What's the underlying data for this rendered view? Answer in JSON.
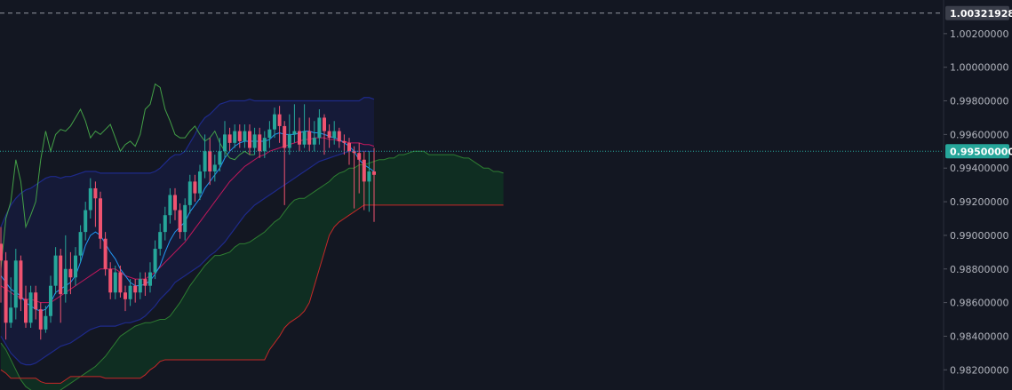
{
  "chart_data": {
    "type": "candlestick",
    "y_axis": {
      "ticks": [
        "1.00200000",
        "1.00000000",
        "0.99800000",
        "0.99600000",
        "0.99400000",
        "0.99200000",
        "0.99000000",
        "0.98800000",
        "0.98600000",
        "0.98400000",
        "0.98200000"
      ],
      "tick_values": [
        1.002,
        1.0,
        0.998,
        0.996,
        0.994,
        0.992,
        0.99,
        0.988,
        0.986,
        0.984,
        0.982
      ],
      "range": [
        0.9808,
        1.004
      ],
      "side": "right"
    },
    "price_lines": [
      {
        "label": "1.00321928",
        "value": 1.00321928,
        "style": "dashed",
        "line_color": "#9598a1",
        "tag_bg": "#3a3e4a",
        "tag_fg": "#ffffff"
      },
      {
        "label": "0.99500000",
        "value": 0.995,
        "style": "dotted",
        "line_color": "#26a69a",
        "tag_bg": "#26a69a",
        "tag_fg": "#ffffff"
      }
    ],
    "candles": [
      [
        0.9895,
        0.9885,
        0.986,
        0.9905
      ],
      [
        0.9885,
        0.9848,
        0.9838,
        0.989
      ],
      [
        0.9848,
        0.9857,
        0.9845,
        0.9875
      ],
      [
        0.9857,
        0.9885,
        0.985,
        0.9892
      ],
      [
        0.9885,
        0.9862,
        0.9855,
        0.9888
      ],
      [
        0.9862,
        0.9848,
        0.9845,
        0.987
      ],
      [
        0.9848,
        0.9866,
        0.9845,
        0.987
      ],
      [
        0.9866,
        0.9856,
        0.985,
        0.987
      ],
      [
        0.9856,
        0.9844,
        0.9838,
        0.986
      ],
      [
        0.9844,
        0.9852,
        0.9842,
        0.9858
      ],
      [
        0.9852,
        0.987,
        0.9848,
        0.9876
      ],
      [
        0.987,
        0.9888,
        0.9865,
        0.9893
      ],
      [
        0.9888,
        0.9865,
        0.9848,
        0.9892
      ],
      [
        0.9865,
        0.988,
        0.986,
        0.99
      ],
      [
        0.988,
        0.9875,
        0.9865,
        0.989
      ],
      [
        0.9875,
        0.9888,
        0.987,
        0.9893
      ],
      [
        0.9888,
        0.9902,
        0.9884,
        0.9906
      ],
      [
        0.9902,
        0.9915,
        0.9897,
        0.992
      ],
      [
        0.9915,
        0.9928,
        0.991,
        0.9934
      ],
      [
        0.9928,
        0.9922,
        0.9905,
        0.9932
      ],
      [
        0.9922,
        0.9898,
        0.9892,
        0.9926
      ],
      [
        0.9898,
        0.988,
        0.9876,
        0.9902
      ],
      [
        0.988,
        0.9866,
        0.9862,
        0.9884
      ],
      [
        0.9866,
        0.9878,
        0.9862,
        0.9882
      ],
      [
        0.9878,
        0.9866,
        0.9863,
        0.9882
      ],
      [
        0.9866,
        0.9862,
        0.9855,
        0.987
      ],
      [
        0.9862,
        0.987,
        0.9858,
        0.9874
      ],
      [
        0.987,
        0.9866,
        0.986,
        0.9874
      ],
      [
        0.9866,
        0.9874,
        0.9862,
        0.9878
      ],
      [
        0.9874,
        0.987,
        0.9864,
        0.9878
      ],
      [
        0.987,
        0.9878,
        0.9866,
        0.9884
      ],
      [
        0.9878,
        0.9892,
        0.9874,
        0.9897
      ],
      [
        0.9892,
        0.9902,
        0.9888,
        0.9907
      ],
      [
        0.9902,
        0.9912,
        0.9897,
        0.9917
      ],
      [
        0.9912,
        0.9924,
        0.9907,
        0.9928
      ],
      [
        0.9924,
        0.9915,
        0.9909,
        0.9928
      ],
      [
        0.9915,
        0.9902,
        0.9898,
        0.9919
      ],
      [
        0.9902,
        0.9918,
        0.9897,
        0.9922
      ],
      [
        0.9918,
        0.9932,
        0.9913,
        0.9936
      ],
      [
        0.9932,
        0.9925,
        0.992,
        0.9936
      ],
      [
        0.9925,
        0.9938,
        0.9921,
        0.9942
      ],
      [
        0.9938,
        0.995,
        0.9934,
        0.996
      ],
      [
        0.995,
        0.9938,
        0.993,
        0.9958
      ],
      [
        0.9938,
        0.9942,
        0.9932,
        0.9948
      ],
      [
        0.9942,
        0.995,
        0.9938,
        0.9958
      ],
      [
        0.995,
        0.996,
        0.9946,
        0.9968
      ],
      [
        0.996,
        0.9955,
        0.995,
        0.9964
      ],
      [
        0.9955,
        0.9962,
        0.9952,
        0.9966
      ],
      [
        0.9962,
        0.9956,
        0.9952,
        0.9966
      ],
      [
        0.9956,
        0.9962,
        0.9952,
        0.9966
      ],
      [
        0.9962,
        0.9952,
        0.9948,
        0.9966
      ],
      [
        0.9952,
        0.996,
        0.9948,
        0.9964
      ],
      [
        0.996,
        0.995,
        0.9946,
        0.9964
      ],
      [
        0.995,
        0.9958,
        0.9946,
        0.9962
      ],
      [
        0.9958,
        0.9963,
        0.9952,
        0.9968
      ],
      [
        0.9963,
        0.9972,
        0.9958,
        0.9976
      ],
      [
        0.9972,
        0.9965,
        0.9955,
        0.9977
      ],
      [
        0.9965,
        0.9952,
        0.9918,
        0.9968
      ],
      [
        0.9952,
        0.996,
        0.9948,
        0.9972
      ],
      [
        0.996,
        0.9962,
        0.9955,
        0.9978
      ],
      [
        0.9962,
        0.9954,
        0.995,
        0.997
      ],
      [
        0.9954,
        0.9962,
        0.9952,
        0.9978
      ],
      [
        0.9962,
        0.9954,
        0.995,
        0.997
      ],
      [
        0.9954,
        0.9958,
        0.995,
        0.9968
      ],
      [
        0.9958,
        0.997,
        0.9954,
        0.9975
      ],
      [
        0.997,
        0.9962,
        0.9948,
        0.9972
      ],
      [
        0.9962,
        0.9958,
        0.9952,
        0.9966
      ],
      [
        0.9958,
        0.9962,
        0.9954,
        0.9968
      ],
      [
        0.9962,
        0.9956,
        0.9952,
        0.9964
      ],
      [
        0.9956,
        0.9955,
        0.9948,
        0.996
      ],
      [
        0.9955,
        0.995,
        0.9942,
        0.9958
      ],
      [
        0.995,
        0.9949,
        0.9916,
        0.9953
      ],
      [
        0.9949,
        0.9945,
        0.9925,
        0.9955
      ],
      [
        0.9945,
        0.9932,
        0.9915,
        0.995
      ],
      [
        0.9932,
        0.9938,
        0.9914,
        0.995
      ],
      [
        0.9938,
        0.9936,
        0.9908,
        0.9952
      ]
    ],
    "tenkan_sen": [
      0.9876,
      0.9872,
      0.9868,
      0.9866,
      0.9864,
      0.986,
      0.9858,
      0.9856,
      0.9855,
      0.9856,
      0.986,
      0.9866,
      0.9868,
      0.987,
      0.9872,
      0.9876,
      0.9884,
      0.9894,
      0.99,
      0.9902,
      0.99,
      0.9895,
      0.989,
      0.9886,
      0.988,
      0.9876,
      0.9872,
      0.987,
      0.987,
      0.9871,
      0.9873,
      0.9877,
      0.9882,
      0.989,
      0.9897,
      0.9902,
      0.9905,
      0.9908,
      0.9914,
      0.9918,
      0.9922,
      0.9928,
      0.9932,
      0.9936,
      0.994,
      0.9946,
      0.995,
      0.9953,
      0.9955,
      0.9956,
      0.9956,
      0.9956,
      0.9956,
      0.9956,
      0.9957,
      0.996,
      0.9961,
      0.996,
      0.996,
      0.996,
      0.9961,
      0.9962,
      0.9962,
      0.9961,
      0.9961,
      0.996,
      0.9959,
      0.9958,
      0.9957,
      0.9955,
      0.9953,
      0.995,
      0.9945,
      0.9942,
      0.994,
      0.9938
    ],
    "kijun_sen": [
      0.987,
      0.9868,
      0.9866,
      0.9864,
      0.9863,
      0.9862,
      0.9862,
      0.9861,
      0.986,
      0.986,
      0.986,
      0.9862,
      0.9864,
      0.9866,
      0.9868,
      0.987,
      0.9872,
      0.9874,
      0.9876,
      0.9878,
      0.988,
      0.988,
      0.988,
      0.988,
      0.9878,
      0.9876,
      0.9875,
      0.9874,
      0.9874,
      0.9874,
      0.9876,
      0.9878,
      0.9881,
      0.9884,
      0.9887,
      0.989,
      0.9893,
      0.9896,
      0.99,
      0.9904,
      0.9908,
      0.9912,
      0.9916,
      0.992,
      0.9924,
      0.9928,
      0.9932,
      0.9935,
      0.9938,
      0.9941,
      0.9943,
      0.9945,
      0.9947,
      0.9948,
      0.995,
      0.9951,
      0.9952,
      0.9953,
      0.9954,
      0.9955,
      0.9956,
      0.9957,
      0.9957,
      0.9958,
      0.9958,
      0.9958,
      0.9957,
      0.9957,
      0.9956,
      0.9956,
      0.9955,
      0.9955,
      0.9955,
      0.9954,
      0.9954,
      0.9953
    ],
    "chikou_span": [
      0.988,
      0.991,
      0.992,
      0.9945,
      0.9932,
      0.9905,
      0.9912,
      0.992,
      0.9945,
      0.9962,
      0.995,
      0.996,
      0.9963,
      0.9962,
      0.9965,
      0.997,
      0.9975,
      0.9968,
      0.9958,
      0.9962,
      0.996,
      0.9963,
      0.9966,
      0.9958,
      0.995,
      0.9954,
      0.9956,
      0.9953,
      0.996,
      0.9975,
      0.9978,
      0.999,
      0.9988,
      0.9975,
      0.9968,
      0.996,
      0.9958,
      0.9958,
      0.9962,
      0.9965,
      0.996,
      0.9956,
      0.9958,
      0.9962,
      0.9955,
      0.995,
      0.9946,
      0.9945,
      0.9948,
      0.995,
      0.9948,
      0.9948
    ],
    "senkou_span_a": [
      0.9836,
      0.9832,
      0.9826,
      0.982,
      0.9814,
      0.981,
      0.9808,
      0.9806,
      0.9805,
      0.9805,
      0.9806,
      0.9806,
      0.9808,
      0.981,
      0.9812,
      0.9814,
      0.9816,
      0.9818,
      0.982,
      0.9822,
      0.9825,
      0.9828,
      0.9832,
      0.9836,
      0.984,
      0.9842,
      0.9844,
      0.9846,
      0.9847,
      0.9848,
      0.9848,
      0.9849,
      0.985,
      0.985,
      0.9852,
      0.9856,
      0.986,
      0.9865,
      0.987,
      0.9874,
      0.9878,
      0.9882,
      0.9885,
      0.9888,
      0.9888,
      0.9889,
      0.989,
      0.9893,
      0.9895,
      0.9895,
      0.9896,
      0.9898,
      0.99,
      0.9902,
      0.9905,
      0.9908,
      0.991,
      0.9914,
      0.9918,
      0.9921,
      0.9922,
      0.9922,
      0.9924,
      0.9926,
      0.9928,
      0.993,
      0.9932,
      0.9935,
      0.9937,
      0.9938,
      0.994,
      0.994,
      0.9942,
      0.9942,
      0.9943,
      0.9944,
      0.9945,
      0.9945,
      0.9946,
      0.9946,
      0.9948,
      0.9948,
      0.9949,
      0.995,
      0.995,
      0.995,
      0.9948,
      0.9948,
      0.9948,
      0.9948,
      0.9948,
      0.9948,
      0.9947,
      0.9946,
      0.9946,
      0.9944,
      0.9942,
      0.994,
      0.994,
      0.9938,
      0.9938,
      0.9937
    ],
    "senkou_span_b": [
      0.982,
      0.9818,
      0.9815,
      0.9815,
      0.9815,
      0.9815,
      0.9815,
      0.9815,
      0.9813,
      0.9812,
      0.9812,
      0.9812,
      0.9812,
      0.9814,
      0.9816,
      0.9816,
      0.9816,
      0.9816,
      0.9816,
      0.9816,
      0.9816,
      0.9815,
      0.9815,
      0.9815,
      0.9815,
      0.9815,
      0.9815,
      0.9815,
      0.9815,
      0.9817,
      0.982,
      0.9822,
      0.9825,
      0.9826,
      0.9826,
      0.9826,
      0.9826,
      0.9826,
      0.9826,
      0.9826,
      0.9826,
      0.9826,
      0.9826,
      0.9826,
      0.9826,
      0.9826,
      0.9826,
      0.9826,
      0.9826,
      0.9826,
      0.9826,
      0.9826,
      0.9826,
      0.9826,
      0.9832,
      0.9836,
      0.984,
      0.9845,
      0.9848,
      0.985,
      0.9852,
      0.9855,
      0.986,
      0.987,
      0.988,
      0.989,
      0.99,
      0.9905,
      0.9908,
      0.991,
      0.9912,
      0.9914,
      0.9916,
      0.9918,
      0.9918,
      0.9918,
      0.9918,
      0.9918,
      0.9918,
      0.9918,
      0.9918,
      0.9918,
      0.9918,
      0.9918,
      0.9918,
      0.9918,
      0.9918,
      0.9918,
      0.9918,
      0.9918,
      0.9918,
      0.9918,
      0.9918,
      0.9918,
      0.9918,
      0.9918,
      0.9918,
      0.9918,
      0.9918,
      0.9918,
      0.9918,
      0.9918
    ],
    "bollinger_upper": [
      0.9905,
      0.9912,
      0.9918,
      0.9922,
      0.9925,
      0.9927,
      0.9928,
      0.993,
      0.9932,
      0.9934,
      0.9935,
      0.9935,
      0.9934,
      0.9935,
      0.9935,
      0.9936,
      0.9937,
      0.9938,
      0.9938,
      0.9938,
      0.9937,
      0.9937,
      0.9937,
      0.9937,
      0.9937,
      0.9937,
      0.9937,
      0.9937,
      0.9937,
      0.9937,
      0.9937,
      0.9938,
      0.994,
      0.9943,
      0.9946,
      0.9948,
      0.9948,
      0.995,
      0.9955,
      0.996,
      0.9966,
      0.997,
      0.9972,
      0.9975,
      0.9978,
      0.9979,
      0.998,
      0.998,
      0.998,
      0.998,
      0.9981,
      0.998,
      0.998,
      0.998,
      0.998,
      0.998,
      0.998,
      0.998,
      0.998,
      0.998,
      0.998,
      0.998,
      0.998,
      0.998,
      0.998,
      0.998,
      0.998,
      0.998,
      0.998,
      0.998,
      0.998,
      0.998,
      0.998,
      0.9982,
      0.9982,
      0.9981
    ],
    "bollinger_lower": [
      0.984,
      0.9835,
      0.983,
      0.9827,
      0.9824,
      0.9823,
      0.9823,
      0.9824,
      0.9826,
      0.9828,
      0.983,
      0.9832,
      0.9834,
      0.9835,
      0.9836,
      0.9838,
      0.984,
      0.9842,
      0.9844,
      0.9845,
      0.9846,
      0.9846,
      0.9846,
      0.9846,
      0.9847,
      0.9848,
      0.9848,
      0.9849,
      0.985,
      0.9852,
      0.9855,
      0.9858,
      0.9862,
      0.9865,
      0.9868,
      0.9872,
      0.9874,
      0.9876,
      0.9878,
      0.988,
      0.9882,
      0.9885,
      0.9888,
      0.989,
      0.9893,
      0.9896,
      0.99,
      0.9904,
      0.9908,
      0.9912,
      0.9915,
      0.9918,
      0.992,
      0.9922,
      0.9924,
      0.9926,
      0.9928,
      0.993,
      0.9932,
      0.9934,
      0.9936,
      0.9938,
      0.994,
      0.9942,
      0.9944,
      0.9945,
      0.9946,
      0.9947,
      0.9948,
      0.9949,
      0.995,
      0.995,
      0.995,
      0.995,
      0.995,
      0.995
    ],
    "colors": {
      "background": "#131722",
      "bull": "#26a69a",
      "bear": "#ef5370",
      "tenkan": "#2196f3",
      "kijun": "#c2185b",
      "chikou": "#43a047",
      "span_a": "#2e7d32",
      "span_b": "#c62828",
      "cloud_bull": "#0f3322",
      "bollinger_band": "#1a2060",
      "bollinger_line": "#1e2a8a",
      "grid": "#1e222d",
      "axis_text": "#b2b5be"
    },
    "grid": false
  }
}
